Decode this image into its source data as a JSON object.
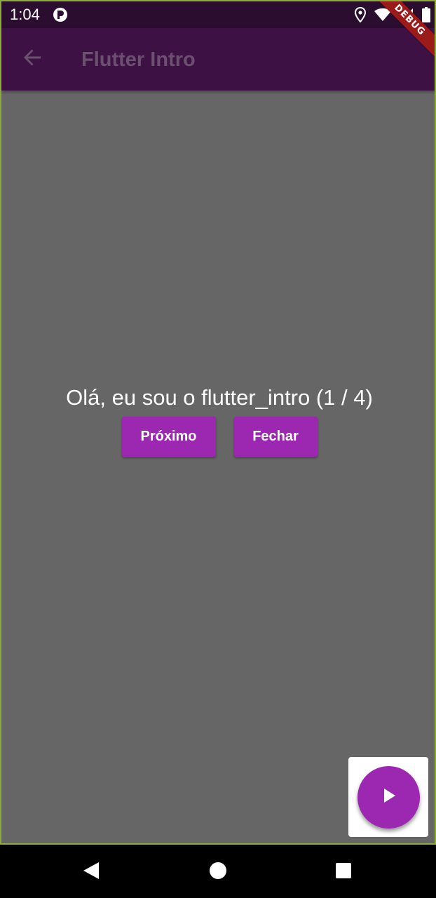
{
  "status_bar": {
    "time": "1:04",
    "icons": [
      "p-app-icon",
      "location-icon",
      "wifi-icon",
      "signal-icon",
      "battery-icon"
    ]
  },
  "app_bar": {
    "title": "Flutter Intro",
    "back_icon": "arrow-back-icon"
  },
  "debug_banner": {
    "label": "DEBUG"
  },
  "intro": {
    "message": "Olá, eu sou o flutter_intro (1 / 4)",
    "next_label": "Próximo",
    "close_label": "Fechar"
  },
  "fab": {
    "icon": "play-icon"
  },
  "nav_bar": {
    "icons": [
      "back-triangle-icon",
      "home-circle-icon",
      "recents-square-icon"
    ]
  },
  "colors": {
    "accent": "#9c27b0",
    "app_bar": "#3d1143",
    "status_bar": "#2b0e2f",
    "overlay": "#666666",
    "debug": "#9b1b1b"
  }
}
